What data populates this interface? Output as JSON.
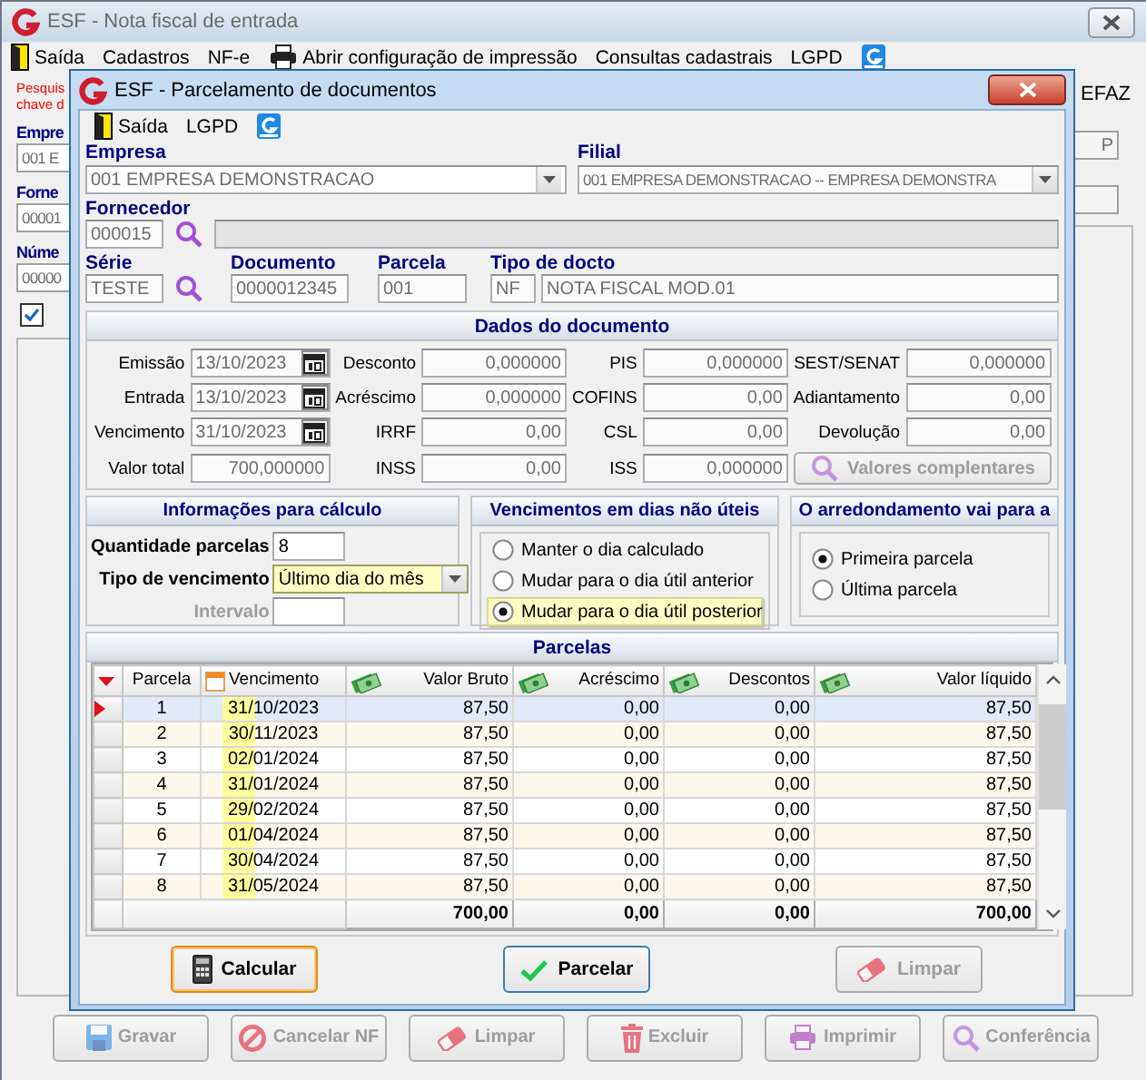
{
  "main_window": {
    "title": "ESF - Nota fiscal de entrada",
    "menu": [
      {
        "kind": "exit",
        "label": "Saída"
      },
      {
        "kind": "text",
        "label": "Cadastros"
      },
      {
        "kind": "text",
        "label": "NF-e"
      },
      {
        "kind": "print",
        "label": "Abrir configuração de impressão"
      },
      {
        "kind": "text",
        "label": "Consultas cadastrais"
      },
      {
        "kind": "text",
        "label": "LGPD"
      },
      {
        "kind": "app"
      }
    ],
    "background_left": [
      {
        "kind": "warning",
        "text": "Pesquis"
      },
      {
        "kind": "warning",
        "text": "chave d"
      },
      {
        "kind": "label",
        "text": "Empre"
      },
      {
        "kind": "field",
        "text": "001 E"
      },
      {
        "kind": "label",
        "text": "Forne"
      },
      {
        "kind": "field",
        "text": "00001"
      },
      {
        "kind": "label",
        "text": "Núme"
      },
      {
        "kind": "field",
        "text": "00000"
      },
      {
        "kind": "checkbox",
        "checked": true
      }
    ],
    "background_right": [
      {
        "kind": "label",
        "text": "EFAZ"
      },
      {
        "kind": "field",
        "text": "P"
      },
      {
        "kind": "field"
      }
    ],
    "buttons": [
      {
        "kind": "save",
        "label": "Gravar",
        "disabled": true
      },
      {
        "kind": "cancel",
        "label": "Cancelar NF",
        "disabled": true
      },
      {
        "kind": "eraser",
        "label": "Limpar",
        "disabled": true
      },
      {
        "kind": "delete",
        "label": "Excluir",
        "disabled": true
      },
      {
        "kind": "print",
        "label": "Imprimir",
        "disabled": true
      },
      {
        "kind": "search",
        "label": "Conferência",
        "disabled": true
      }
    ]
  },
  "dialog": {
    "title": "ESF - Parcelamento de documentos",
    "menu": [
      {
        "kind": "exit",
        "label": "Saída"
      },
      {
        "kind": "text",
        "label": "LGPD"
      },
      {
        "kind": "app"
      }
    ],
    "empresa": {
      "label": "Empresa",
      "value": "001 EMPRESA DEMONSTRACAO"
    },
    "filial": {
      "label": "Filial",
      "value": "001 EMPRESA DEMONSTRACAO -- EMPRESA DEMONSTRA"
    },
    "fornecedor": {
      "label": "Fornecedor",
      "code": "000015"
    },
    "serie": {
      "label": "Série",
      "value": "TESTE"
    },
    "documento": {
      "label": "Documento",
      "value": "0000012345"
    },
    "parcela": {
      "label": "Parcela",
      "value": "001"
    },
    "tipo_docto": {
      "label": "Tipo de docto",
      "code": "NF",
      "name": "NOTA FISCAL MOD.01"
    },
    "dados": {
      "title": "Dados do documento",
      "fields": [
        {
          "kind": "date",
          "label": "Emissão",
          "value": "13/10/2023"
        },
        {
          "kind": "value",
          "label": "Desconto",
          "value": "0,000000"
        },
        {
          "kind": "value",
          "label": "PIS",
          "value": "0,000000"
        },
        {
          "kind": "value",
          "label": "SEST/SENAT",
          "value": "0,000000"
        },
        {
          "kind": "date",
          "label": "Entrada",
          "value": "13/10/2023"
        },
        {
          "kind": "value",
          "label": "Acréscimo",
          "value": "0,000000"
        },
        {
          "kind": "value",
          "label": "COFINS",
          "value": "0,00"
        },
        {
          "kind": "value",
          "label": "Adiantamento",
          "value": "0,00"
        },
        {
          "kind": "date",
          "label": "Vencimento",
          "value": "31/10/2023"
        },
        {
          "kind": "value",
          "label": "IRRF",
          "value": "0,00"
        },
        {
          "kind": "value",
          "label": "CSL",
          "value": "0,00"
        },
        {
          "kind": "value",
          "label": "Devolução",
          "value": "0,00"
        },
        {
          "kind": "value",
          "label": "Valor total",
          "value": "700,000000"
        },
        {
          "kind": "value",
          "label": "INSS",
          "value": "0,00"
        },
        {
          "kind": "value",
          "label": "ISS",
          "value": "0,000000"
        },
        {
          "kind": "button",
          "label": "Valores complentares",
          "disabled": true
        }
      ]
    },
    "calculo": {
      "title": "Informações para cálculo",
      "quantidade": {
        "label": "Quantidade parcelas",
        "value": "8"
      },
      "tipo_vencimento": {
        "label": "Tipo de vencimento",
        "value": "Último dia do mês",
        "highlighted": true
      },
      "intervalo": {
        "label": "Intervalo",
        "disabled": true
      }
    },
    "dias_nao_uteis": {
      "title": "Vencimentos em dias não úteis",
      "options": [
        {
          "label": "Manter o dia calculado",
          "selected": false,
          "highlighted": false
        },
        {
          "label": "Mudar para o dia útil anterior",
          "selected": false,
          "highlighted": false
        },
        {
          "label": "Mudar para o dia útil posterior",
          "selected": true,
          "highlighted": true
        }
      ]
    },
    "arredondamento": {
      "title": "O arredondamento vai para a",
      "options": [
        {
          "label": "Primeira parcela",
          "selected": true
        },
        {
          "label": "Última parcela",
          "selected": false
        }
      ]
    },
    "parcelas": {
      "title": "Parcelas",
      "columns": [
        {
          "kind": "plain",
          "label": "Parcela"
        },
        {
          "kind": "date",
          "label": "Vencimento"
        },
        {
          "kind": "money",
          "label": "Valor Bruto"
        },
        {
          "kind": "money",
          "label": "Acréscimo"
        },
        {
          "kind": "money",
          "label": "Descontos"
        },
        {
          "kind": "money",
          "label": "Valor líquido"
        }
      ],
      "rows": [
        {
          "selected": true,
          "cells": [
            "1",
            "31/10/2023",
            "87,50",
            "0,00",
            "0,00",
            "87,50"
          ]
        },
        {
          "selected": false,
          "cells": [
            "2",
            "30/11/2023",
            "87,50",
            "0,00",
            "0,00",
            "87,50"
          ]
        },
        {
          "selected": false,
          "cells": [
            "3",
            "02/01/2024",
            "87,50",
            "0,00",
            "0,00",
            "87,50"
          ]
        },
        {
          "selected": false,
          "cells": [
            "4",
            "31/01/2024",
            "87,50",
            "0,00",
            "0,00",
            "87,50"
          ]
        },
        {
          "selected": false,
          "cells": [
            "5",
            "29/02/2024",
            "87,50",
            "0,00",
            "0,00",
            "87,50"
          ]
        },
        {
          "selected": false,
          "cells": [
            "6",
            "01/04/2024",
            "87,50",
            "0,00",
            "0,00",
            "87,50"
          ]
        },
        {
          "selected": false,
          "cells": [
            "7",
            "30/04/2024",
            "87,50",
            "0,00",
            "0,00",
            "87,50"
          ]
        },
        {
          "selected": false,
          "cells": [
            "8",
            "31/05/2024",
            "87,50",
            "0,00",
            "0,00",
            "87,50"
          ]
        }
      ],
      "totals": [
        "700,00",
        "0,00",
        "0,00",
        "700,00"
      ]
    },
    "buttons": [
      {
        "kind": "calculator",
        "label": "Calcular",
        "focused": true,
        "default": false,
        "disabled": false
      },
      {
        "kind": "check",
        "label": "Parcelar",
        "focused": false,
        "default": true,
        "disabled": false
      },
      {
        "kind": "eraser",
        "label": "Limpar",
        "focused": false,
        "default": false,
        "disabled": true
      }
    ]
  }
}
